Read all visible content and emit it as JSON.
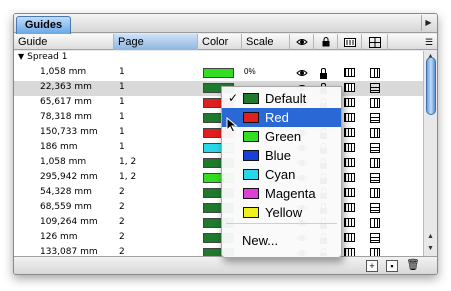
{
  "tab": {
    "label": "Guides"
  },
  "columns": {
    "guide": "Guide",
    "page": "Page",
    "color": "Color",
    "scale": "Scale"
  },
  "tree": {
    "group_label": "Spread 1"
  },
  "rows": [
    {
      "guide": "1,058 mm",
      "page": "1",
      "color": "#33dd22",
      "scale": "0%"
    },
    {
      "guide": "22,363 mm",
      "page": "1",
      "color": "#1f7a2e",
      "scale": ""
    },
    {
      "guide": "65,617 mm",
      "page": "1",
      "color": "#e02020",
      "scale": ""
    },
    {
      "guide": "78,318 mm",
      "page": "1",
      "color": "#1f7a2e",
      "scale": ""
    },
    {
      "guide": "150,733 mm",
      "page": "1",
      "color": "#e02020",
      "scale": ""
    },
    {
      "guide": "186 mm",
      "page": "1",
      "color": "#29d8e8",
      "scale": ""
    },
    {
      "guide": "1,058 mm",
      "page": "1, 2",
      "color": "#1f7a2e",
      "scale": ""
    },
    {
      "guide": "295,942 mm",
      "page": "1, 2",
      "color": "#33dd22",
      "scale": ""
    },
    {
      "guide": "54,328 mm",
      "page": "2",
      "color": "#1f7a2e",
      "scale": ""
    },
    {
      "guide": "68,559 mm",
      "page": "2",
      "color": "#1f7a2e",
      "scale": ""
    },
    {
      "guide": "109,264 mm",
      "page": "2",
      "color": "#1f7a2e",
      "scale": ""
    },
    {
      "guide": "126 mm",
      "page": "2",
      "color": "#1f7a2e",
      "scale": ""
    },
    {
      "guide": "133,087 mm",
      "page": "2",
      "color": "#1f7a2e",
      "scale": ""
    }
  ],
  "color_menu": {
    "items": [
      {
        "label": "Default",
        "color": "#1f7a2e",
        "checked": true
      },
      {
        "label": "Red",
        "color": "#e02020",
        "active": true
      },
      {
        "label": "Green",
        "color": "#33dd22"
      },
      {
        "label": "Blue",
        "color": "#1a3fd8"
      },
      {
        "label": "Cyan",
        "color": "#29d8e8"
      },
      {
        "label": "Magenta",
        "color": "#e040d8"
      },
      {
        "label": "Yellow",
        "color": "#f0f020"
      }
    ],
    "new_label": "New...",
    "checkmark": "✓"
  },
  "icons": {
    "visibility": "eye-icon",
    "lock": "lock-icon",
    "snap": "dots-icon",
    "orientation": "grid-icon"
  }
}
